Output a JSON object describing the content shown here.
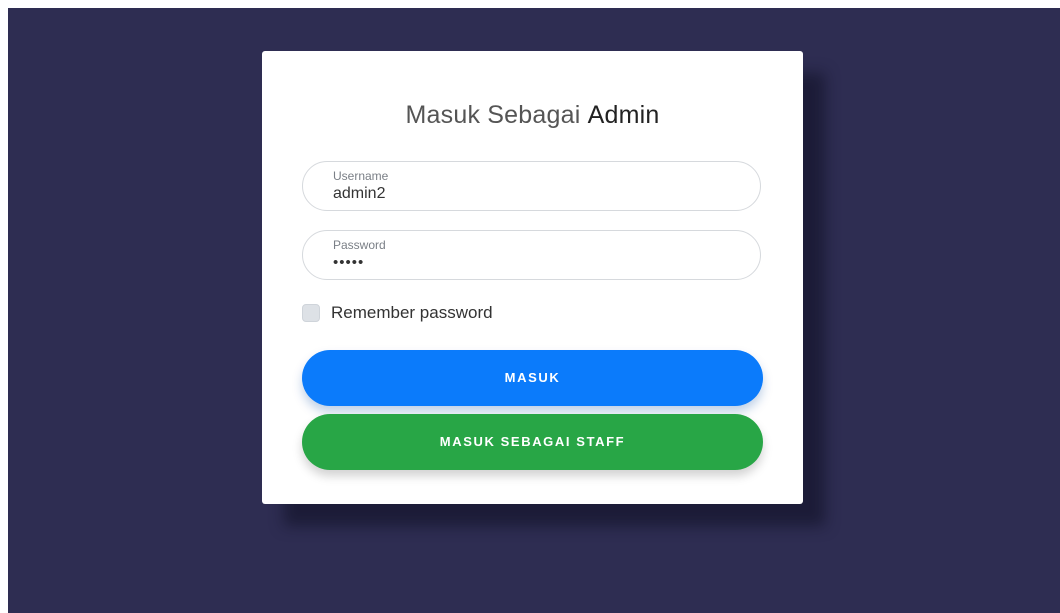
{
  "login": {
    "title_prefix": "Masuk Sebagai",
    "title_role": "Admin",
    "username": {
      "label": "Username",
      "value": "admin2"
    },
    "password": {
      "label": "Password",
      "masked_value": "•••••"
    },
    "remember_label": "Remember password",
    "remember_checked": false,
    "submit_label": "MASUK",
    "staff_label": "MASUK SEBAGAI STAFF"
  },
  "colors": {
    "background": "#2e2d52",
    "card": "#ffffff",
    "primary_button": "#0b7bfb",
    "success_button": "#28a646"
  }
}
